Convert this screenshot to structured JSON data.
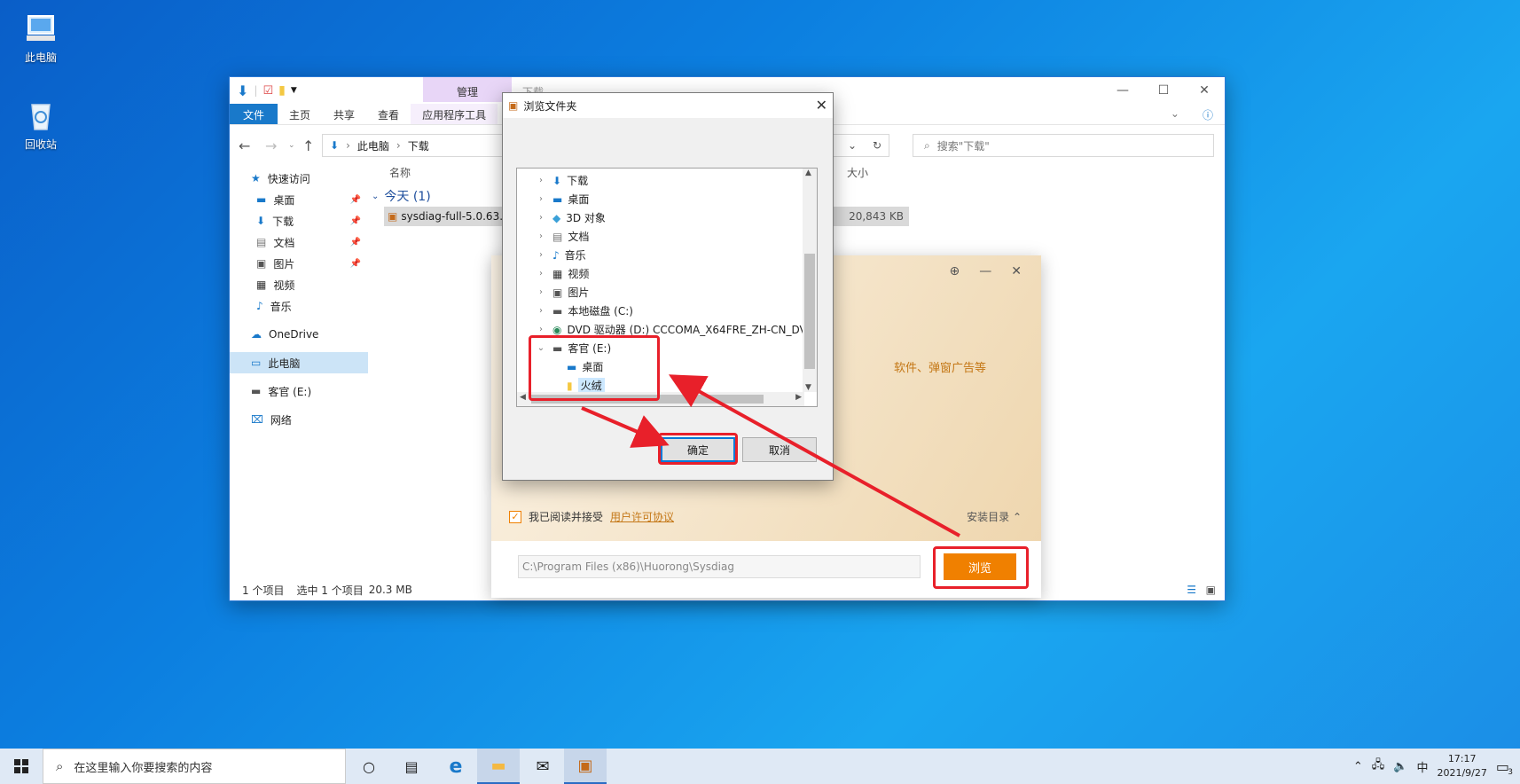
{
  "desktop": {
    "icons": [
      {
        "label": "此电脑"
      },
      {
        "label": "回收站"
      }
    ]
  },
  "explorer": {
    "manage_tab": "管理",
    "title": "下载",
    "ribbon": {
      "file": "文件",
      "home": "主页",
      "share": "共享",
      "view": "查看",
      "app_tools": "应用程序工具"
    },
    "address": {
      "crumb1": "此电脑",
      "crumb2": "下载"
    },
    "search_placeholder": "搜索\"下载\"",
    "nav": {
      "quick_access": "快速访问",
      "desktop": "桌面",
      "downloads": "下载",
      "documents": "文档",
      "pictures": "图片",
      "videos": "视频",
      "music": "音乐",
      "onedrive": "OneDrive",
      "this_pc": "此电脑",
      "drive_e": "客官 (E:)",
      "network": "网络"
    },
    "columns": {
      "name": "名称",
      "size": "大小"
    },
    "group": "今天 (1)",
    "file": {
      "name": "sysdiag-full-5.0.63.2",
      "size": "20,843 KB"
    },
    "status": {
      "count": "1 个项目",
      "selected": "选中 1 个项目",
      "size": "20.3 MB"
    }
  },
  "installer": {
    "promo": "软件、弹窗广告等",
    "agree_text": "我已阅读并接受",
    "agree_link": "用户许可协议",
    "install_dir_label": "安装目录",
    "path": "C:\\Program Files (x86)\\Huorong\\Sysdiag",
    "browse": "浏览"
  },
  "browse_dialog": {
    "title": "浏览文件夹",
    "tree": [
      {
        "label": "下载"
      },
      {
        "label": "桌面"
      },
      {
        "label": "3D 对象"
      },
      {
        "label": "文档"
      },
      {
        "label": "音乐"
      },
      {
        "label": "视频"
      },
      {
        "label": "图片"
      },
      {
        "label": "本地磁盘 (C:)"
      },
      {
        "label": "DVD 驱动器 (D:) CCCOMA_X64FRE_ZH-CN_DV"
      },
      {
        "label": "客官 (E:)"
      },
      {
        "label": "桌面"
      },
      {
        "label": "火绒"
      }
    ],
    "ok": "确定",
    "cancel": "取消"
  },
  "taskbar": {
    "search_placeholder": "在这里输入你要搜索的内容",
    "ime": "中",
    "time": "17:17",
    "date": "2021/9/27",
    "notification_count": "3"
  },
  "colors": {
    "accent": "#1979ca",
    "annotation": "#e8202a",
    "brand_orange": "#f08000"
  }
}
